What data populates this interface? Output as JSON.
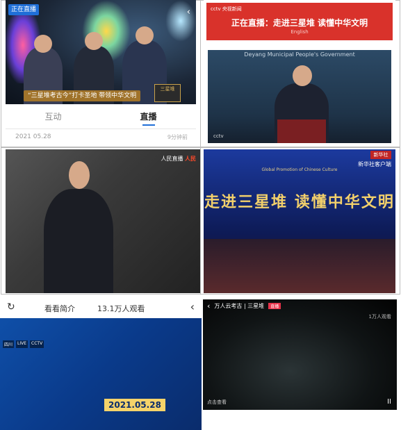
{
  "p1": {
    "live_badge": "正在直播",
    "chevron": "‹",
    "caption": "“三星堆考古今”打卡圣地 带领中华文明",
    "badge": "三星堆",
    "tab_active": "直播",
    "tab_other": "互动",
    "date": "2021 05.28",
    "date_right": "9分钟前"
  },
  "p2": {
    "logo": "cctv 央视新闻",
    "title": "正在直播：走进三星堆 读懂中华文明",
    "subtitle": "English",
    "stage_text": "Deyang Municipal People's Government",
    "watermark": "cctv"
  },
  "p3": {
    "logo_left": "人民直播",
    "logo_right": "人民"
  },
  "p4": {
    "marker": "新华社",
    "watermark": "新华社客户端",
    "line": "Global Promotion of Chinese Culture",
    "big_title": "走进三星堆 读懂中华文明"
  },
  "p5": {
    "clock_icon": "↻",
    "intro": "看看简介",
    "viewers": "13.1万人观看",
    "back": "‹",
    "date_tag": "2021.05.28",
    "tag1": "四川",
    "tag2": "LIVE",
    "tag3": "CCTV"
  },
  "p6": {
    "back": "‹",
    "title": "万人云考古 | 三星堆",
    "live": "直播",
    "viewers": "1万人观看",
    "bottom_left": "点击查看",
    "pause": "II"
  }
}
